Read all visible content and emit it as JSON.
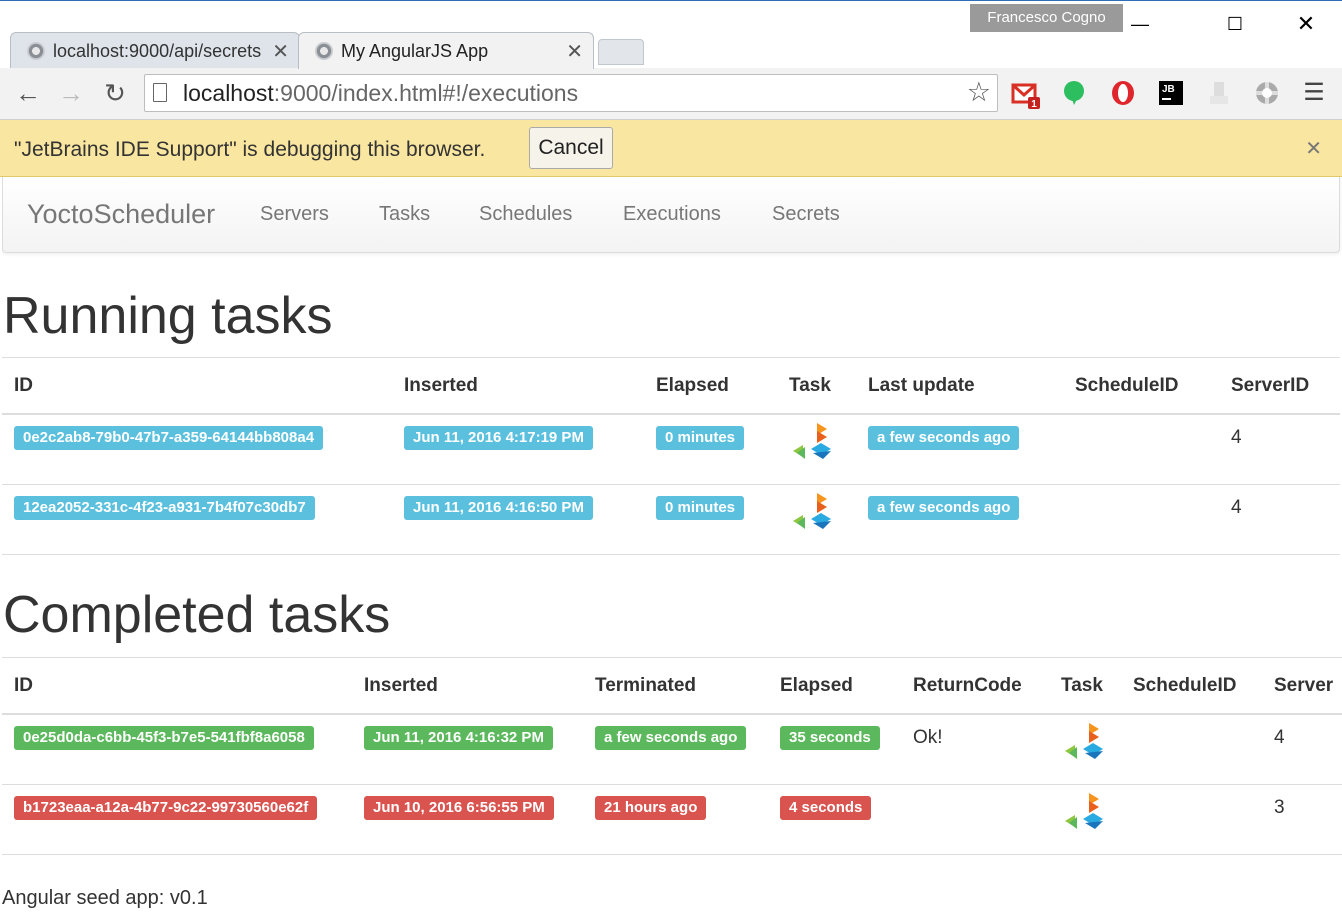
{
  "browser": {
    "profile_name": "Francesco Cogno",
    "tabs": [
      {
        "title": "localhost:9000/api/secrets"
      },
      {
        "title": "My AngularJS App"
      }
    ],
    "url_host": "localhost",
    "url_rest": ":9000/index.html#!/executions",
    "infobar": {
      "message": "\"JetBrains IDE Support\" is debugging this browser.",
      "cancel_label": "Cancel"
    },
    "extensions": [
      "gmail-icon",
      "evernote-icon",
      "opera-icon",
      "jetbrains-icon",
      "user-icon",
      "gear-ext-icon",
      "menu-icon"
    ],
    "gmail_badge": "1"
  },
  "app": {
    "brand": "YoctoScheduler",
    "nav": [
      "Servers",
      "Tasks",
      "Schedules",
      "Executions",
      "Secrets"
    ]
  },
  "running": {
    "title": "Running tasks",
    "headers": [
      "ID",
      "Inserted",
      "Elapsed",
      "Task",
      "Last update",
      "ScheduleID",
      "ServerID"
    ],
    "rows": [
      {
        "id": "0e2c2ab8-79b0-47b7-a359-64144bb808a4",
        "inserted": "Jun 11, 2016 4:17:19 PM",
        "elapsed": "0 minutes",
        "last_update": "a few seconds ago",
        "schedule_id": "",
        "server_id": "4"
      },
      {
        "id": "12ea2052-331c-4f23-a931-7b4f07c30db7",
        "inserted": "Jun 11, 2016 4:16:50 PM",
        "elapsed": "0 minutes",
        "last_update": "a few seconds ago",
        "schedule_id": "",
        "server_id": "4"
      }
    ]
  },
  "completed": {
    "title": "Completed tasks",
    "headers": [
      "ID",
      "Inserted",
      "Terminated",
      "Elapsed",
      "ReturnCode",
      "Task",
      "ScheduleID",
      "Server"
    ],
    "rows": [
      {
        "id": "0e25d0da-c6bb-45f3-b7e5-541fbf8a6058",
        "inserted": "Jun 11, 2016 4:16:32 PM",
        "terminated": "a few seconds ago",
        "elapsed": "35 seconds",
        "return_code": "Ok!",
        "schedule_id": "",
        "server_id": "4",
        "status": "success"
      },
      {
        "id": "b1723eaa-a12a-4b77-9c22-99730560e62f",
        "inserted": "Jun 10, 2016 6:56:55 PM",
        "terminated": "21 hours ago",
        "elapsed": "4 seconds",
        "return_code": "",
        "schedule_id": "",
        "server_id": "3",
        "status": "danger"
      }
    ]
  },
  "footer": "Angular seed app: v0.1",
  "colors": {
    "info": "#5bc0de",
    "success": "#5cb85c",
    "danger": "#d9534f",
    "infobar": "#f9e6a0"
  }
}
